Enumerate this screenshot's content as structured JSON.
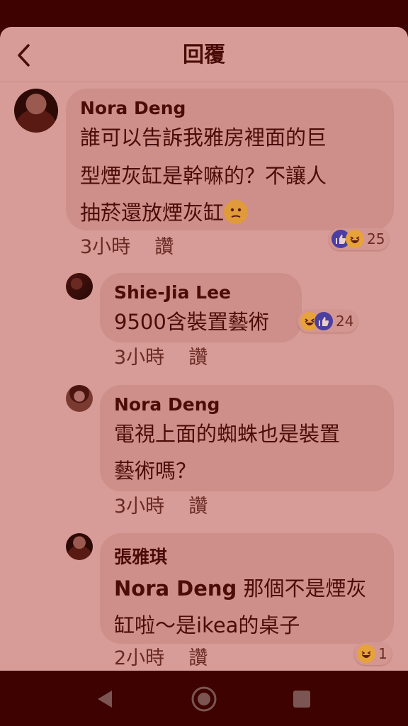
{
  "header": {
    "title": "回覆"
  },
  "comments": [
    {
      "author": "Nora Deng",
      "lines": [
        "誰可以告訴我雅房裡面的巨",
        "型煙灰缸是幹嘛的？不讓人",
        "抽菸還放煙灰缸"
      ],
      "inline_emoji": "thinking-face-emoji",
      "time": "3小時",
      "like": "讚",
      "reactions": {
        "types": [
          "like",
          "haha"
        ],
        "count": "25"
      }
    },
    {
      "author": "Shie-Jia Lee",
      "lines": [
        "9500含裝置藝術"
      ],
      "time": "3小時",
      "like": "讚",
      "reactions": {
        "types": [
          "haha",
          "like"
        ],
        "count": "24"
      }
    },
    {
      "author": "Nora Deng",
      "lines": [
        "電視上面的蜘蛛也是裝置",
        "藝術嗎？"
      ],
      "time": "3小時",
      "like": "讚"
    },
    {
      "author": "張雅琪",
      "mention": "Nora Deng",
      "lines": [
        " 那個不是煙灰",
        "缸啦～是ikea的桌子"
      ],
      "time": "2小時",
      "like": "讚",
      "reactions": {
        "types": [
          "haha"
        ],
        "count": "1"
      }
    }
  ],
  "navbar": {
    "icons": [
      "back-triangle-icon",
      "home-circle-icon",
      "recents-square-icon"
    ]
  },
  "colors": {
    "overlay_tint": "#d79c97",
    "bubble": "#ce8f8a",
    "text": "#4a0c06",
    "system_bar": "#3e0200"
  }
}
